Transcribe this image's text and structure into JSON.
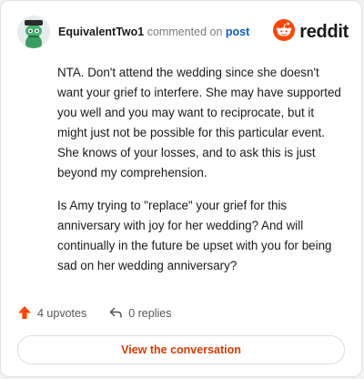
{
  "header": {
    "username": "EquivalentTwo1",
    "action_text": " commented on ",
    "post_link": "post",
    "brand_name": "reddit"
  },
  "comment": {
    "paragraphs": [
      "NTA. Don't attend the wedding since she doesn't want your grief to interfere. She may have supported you well and you may want to reciprocate, but it might just not be possible for this particular event. She knows of your losses, and to ask this is just beyond my comprehension.",
      "Is Amy trying to \"replace\" your grief for this anniversary with joy for her wedding? And will continually in the future be upset with you for being sad on her wedding anniversary?"
    ]
  },
  "footer": {
    "upvotes_label": "4 upvotes",
    "replies_label": "0 replies"
  },
  "cta": {
    "label": "View the conversation"
  },
  "icons": {
    "avatar": "snoo-avatar-icon",
    "brand": "reddit-logo-icon",
    "upvote": "upvote-arrow-icon",
    "reply": "reply-arrow-icon"
  },
  "colors": {
    "brand_orange": "#ff4500",
    "link_blue": "#0b5bd3",
    "cta_text": "#d93a00"
  }
}
